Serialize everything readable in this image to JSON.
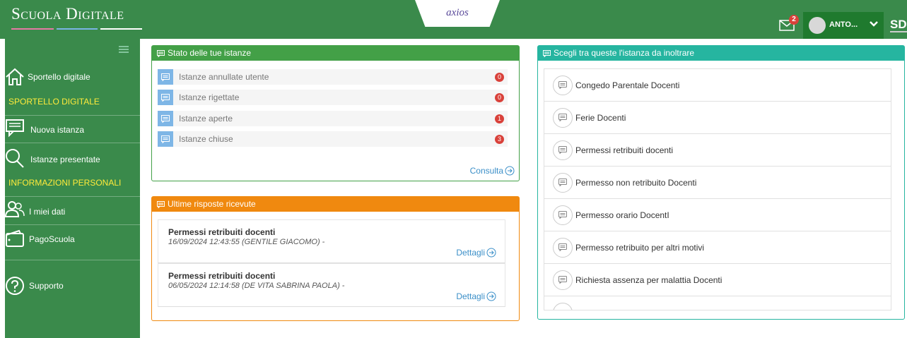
{
  "header": {
    "brand": "Scuola Digitale",
    "axios_logo": "axios",
    "mail_count": "2",
    "user_name": "ANTO...",
    "sd_logo": "SD",
    "brand_line_colors": [
      "#e57aa5",
      "#7ab4e5",
      "#ffffff"
    ]
  },
  "sidebar": {
    "items": [
      {
        "label": "Sportello digitale",
        "icon": "home-icon"
      },
      {
        "label": "Nuova istanza",
        "icon": "chat-icon"
      },
      {
        "label": "Istanze presentate",
        "icon": "search-icon"
      },
      {
        "label": "I miei dati",
        "icon": "users-icon"
      },
      {
        "label": "PagoScuola",
        "icon": "wallet-icon"
      },
      {
        "label": "Supporto",
        "icon": "help-icon"
      }
    ],
    "sections": [
      "SPORTELLO DIGITALE",
      "INFORMAZIONI PERSONALI"
    ]
  },
  "stato": {
    "title": "Stato delle tue istanze",
    "rows": [
      {
        "label": "Istanze annullate utente",
        "count": "0"
      },
      {
        "label": "Istanze rigettate",
        "count": "0"
      },
      {
        "label": "Istanze aperte",
        "count": "1"
      },
      {
        "label": "Istanze chiuse",
        "count": "3"
      }
    ],
    "link": "Consulta"
  },
  "risposte": {
    "title": "Ultime risposte ricevute",
    "items": [
      {
        "title": "Permessi retribuiti docenti",
        "sub": "16/09/2024 12:43:55 (GENTILE GIACOMO) -",
        "link": "Dettagli"
      },
      {
        "title": "Permessi retribuiti docenti",
        "sub": "06/05/2024 12:14:58 (DE VITA SABRINA PAOLA) -",
        "link": "Dettagli"
      }
    ]
  },
  "istanze": {
    "title": "Scegli tra queste l'istanza da inoltrare",
    "items": [
      "Congedo Parentale Docenti",
      "Ferie Docenti",
      "Permessi retribuiti docenti",
      "Permesso non retribuito Docenti",
      "Permesso orario DocentI",
      "Permesso retribuito per altri motivi",
      "Richiesta assenza per malattia Docenti"
    ]
  },
  "colors": {
    "header_green": "#3a8a4b",
    "stato_green": "#43a047",
    "risposte_orange": "#f0890f",
    "istanze_teal": "#26b5a0",
    "badge_red": "#d9413a",
    "section_yellow": "#ffeb3b"
  }
}
